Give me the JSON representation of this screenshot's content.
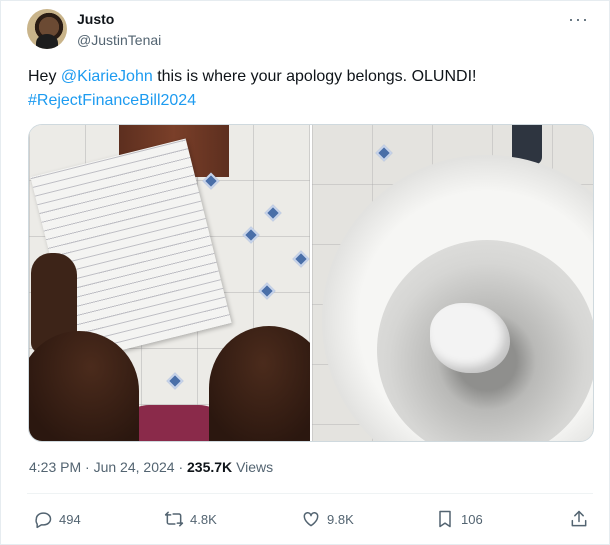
{
  "author": {
    "display_name": "Justo",
    "handle": "@JustinTenai"
  },
  "more_icon": "more-horizontal-icon",
  "tweet": {
    "text_prefix": "Hey ",
    "mention": "@KiarieJohn",
    "text_suffix": " this is where your apology belongs. OLUNDI!",
    "hashtag": "#RejectFinanceBill2024"
  },
  "meta": {
    "time": "4:23 PM",
    "separator": " · ",
    "date": "Jun 24, 2024",
    "views_count": "235.7K",
    "views_label": "Views"
  },
  "actions": {
    "replies": "494",
    "retweets": "4.8K",
    "likes": "9.8K",
    "bookmarks": "106"
  },
  "colors": {
    "link": "#1d9bf0",
    "text": "#0f1419",
    "muted": "#536471"
  }
}
